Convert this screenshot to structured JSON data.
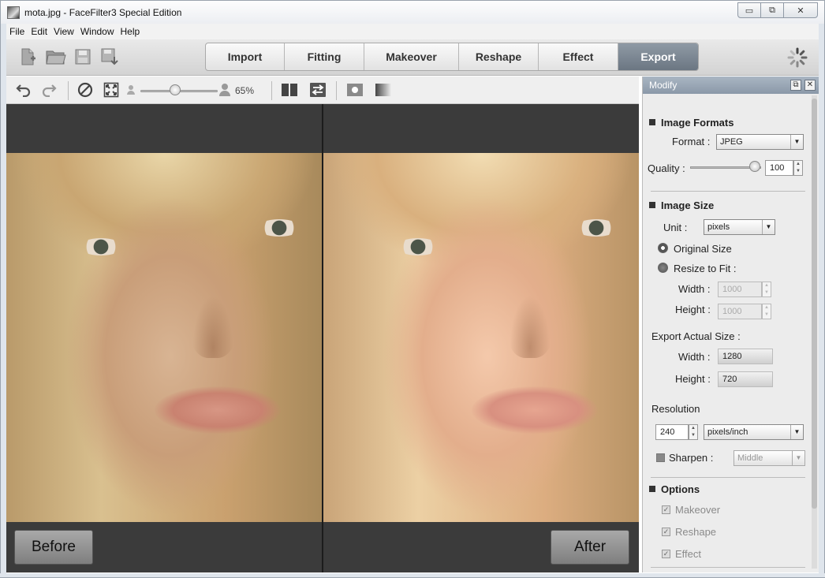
{
  "window": {
    "title": "mota.jpg - FaceFilter3 Special Edition",
    "minimize": "▭",
    "restore": "⧉",
    "close": "✕"
  },
  "menu": [
    "File",
    "Edit",
    "View",
    "Window",
    "Help"
  ],
  "tabs": [
    {
      "label": "Import",
      "active": false
    },
    {
      "label": "Fitting",
      "active": false
    },
    {
      "label": "Makeover",
      "active": false
    },
    {
      "label": "Reshape",
      "active": false
    },
    {
      "label": "Effect",
      "active": false
    },
    {
      "label": "Export",
      "active": true
    }
  ],
  "zoom": {
    "label": "65%",
    "value": 0.45
  },
  "preview": {
    "before_label": "Before",
    "after_label": "After"
  },
  "panel": {
    "title": "Modify",
    "image_formats": {
      "heading": "Image Formats",
      "format_label": "Format :",
      "format_value": "JPEG",
      "quality_label": "Quality :",
      "quality_value": "100"
    },
    "image_size": {
      "heading": "Image Size",
      "unit_label": "Unit :",
      "unit_value": "pixels",
      "original_size": "Original Size",
      "resize_to_fit": "Resize to Fit :",
      "width_label": "Width :",
      "width_value": "1000",
      "height_label": "Height :",
      "height_value": "1000",
      "export_actual_size": "Export Actual Size :",
      "actual_width_label": "Width :",
      "actual_width_value": "1280",
      "actual_height_label": "Height :",
      "actual_height_value": "720"
    },
    "resolution": {
      "label": "Resolution",
      "value": "240",
      "unit": "pixels/inch"
    },
    "sharpen": {
      "label": "Sharpen :",
      "value": "Middle"
    },
    "options": {
      "heading": "Options",
      "items": [
        "Makeover",
        "Reshape",
        "Effect"
      ]
    }
  }
}
